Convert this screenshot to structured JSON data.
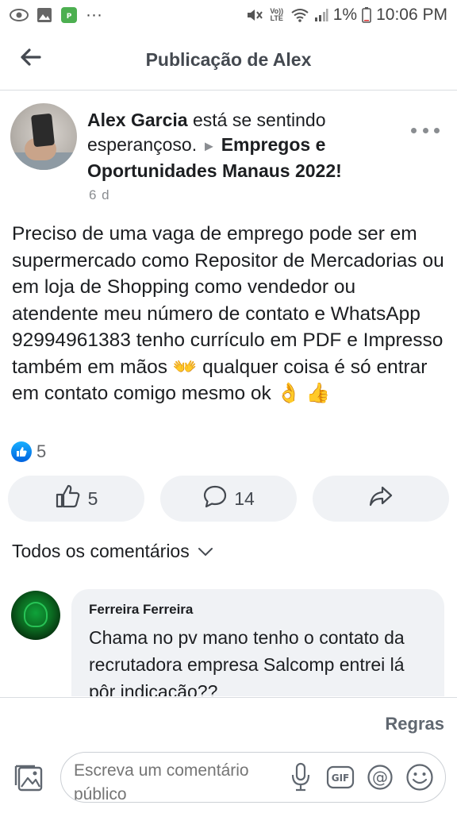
{
  "status_bar": {
    "dots": "···",
    "volte": "Vo)) LTE",
    "battery_percent": "1%",
    "time": "10:06 PM"
  },
  "header": {
    "title": "Publicação de Alex",
    "back_icon": "arrow-left-icon"
  },
  "post": {
    "author": "Alex Garcia",
    "feeling_text": " está se sentindo esperançoso. ",
    "arrow": "►",
    "group": "Empregos e Oportunidades Manaus 2022!",
    "time": "6 d",
    "body": "Preciso de uma vaga de emprego pode ser em supermercado como Repositor de Mercadorias ou em loja de Shopping como vendedor ou atendente meu número de contato e WhatsApp 92994961383 tenho currículo em PDF e Impresso também em mãos 👐 qualquer coisa é só entrar em contato comigo mesmo ok 👌 👍",
    "reaction_count": "5"
  },
  "actions": {
    "like_count": "5",
    "comment_count": "14"
  },
  "comments": {
    "filter_label": "Todos os comentários",
    "items": [
      {
        "author": "Ferreira Ferreira",
        "text": "Chama no pv mano tenho o contato da recrutadora empresa Salcomp entrei lá pôr indicação??"
      }
    ]
  },
  "footer": {
    "rules_label": "Regras",
    "composer_placeholder": "Escreva um comentário público"
  },
  "colors": {
    "like_blue": "#1877f2",
    "button_bg": "#f0f2f5",
    "muted_text": "#65676b"
  }
}
